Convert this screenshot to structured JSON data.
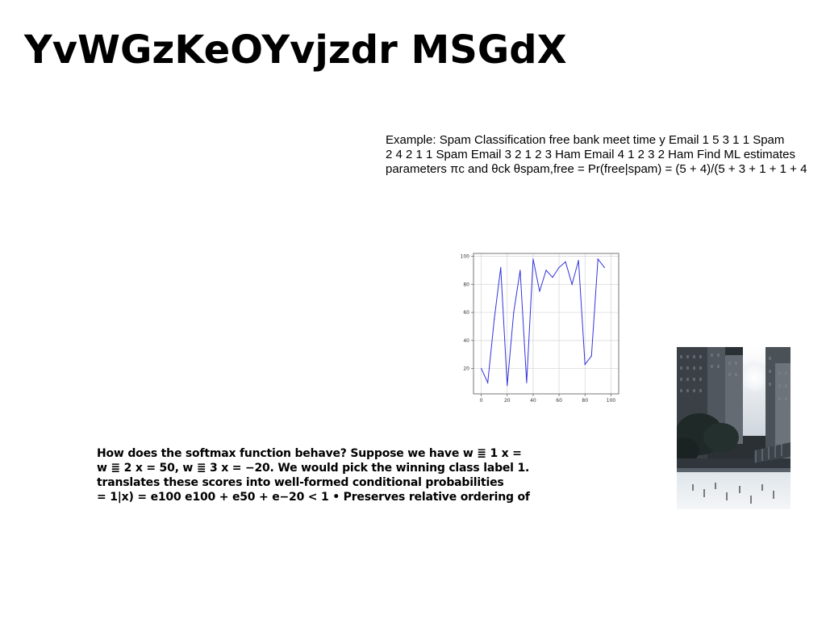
{
  "slide": {
    "title": "YvWGzKeOYvjzdr MSGdX"
  },
  "spam_example": {
    "lines": [
      "Example: Spam Classification free bank meet time y Email 1 5 3 1 1 Spam",
      "2 4 2 1 1 Spam Email 3 2 1 2 3 Ham Email 4 1 2 3 2 Ham Find ML estimates",
      "parameters πc and θck θspam,free = Pr(free|spam) = (5 + 4)/(5 + 3 + 1 + 1 + 4"
    ]
  },
  "softmax_text": {
    "lines": [
      "How does the softmax function behave? Suppose we have w ≣ 1 x =",
      "w ≣ 2 x = 50, w ≣ 3 x = −20. We would pick the winning class label 1.",
      "translates these scores into well-formed conditional probabilities",
      "= 1|x) = e100 e100 + e50 + e−20 < 1 • Preserves relative ordering of"
    ]
  },
  "photo": {
    "icon": "city-street-photo-icon"
  },
  "chart_data": {
    "type": "line",
    "x": [
      0,
      5,
      10,
      15,
      20,
      25,
      30,
      35,
      40,
      45,
      50,
      55,
      60,
      65,
      70,
      75,
      80,
      85,
      90,
      95,
      100
    ],
    "series": [
      {
        "values": [
          20,
          10,
          55,
          92,
          8,
          60,
          90,
          10,
          98,
          75,
          90,
          85,
          92,
          96,
          80,
          97,
          23,
          29,
          98,
          92
        ]
      }
    ],
    "title": "",
    "xlabel": "",
    "ylabel": "",
    "xlim": [
      -6,
      106
    ],
    "ylim": [
      2,
      102
    ],
    "xticks": [
      "0",
      "20",
      "40",
      "60",
      "80",
      "100"
    ],
    "yticks": [
      "20",
      "40",
      "60",
      "80",
      "100"
    ],
    "grid": true,
    "line_color": "#3333dd"
  }
}
